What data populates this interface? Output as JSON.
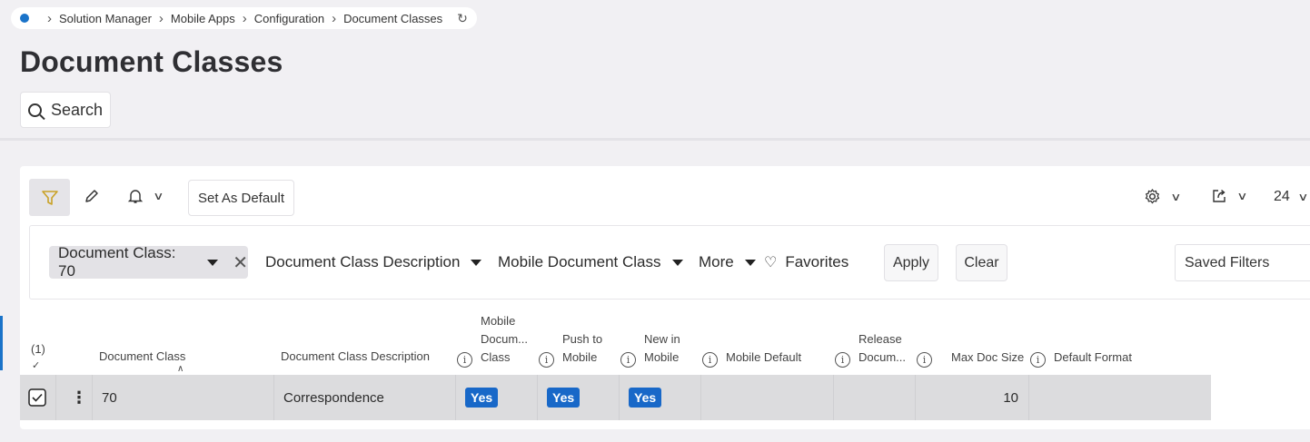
{
  "breadcrumb": {
    "items": [
      "Solution Manager",
      "Mobile Apps",
      "Configuration",
      "Document Classes"
    ]
  },
  "page": {
    "title": "Document Classes",
    "search_label": "Search"
  },
  "toolbar": {
    "set_default_label": "Set As Default",
    "page_size": "24"
  },
  "filters": {
    "chip_label": "Document Class: 70",
    "description_label": "Document Class Description",
    "mobile_class_label": "Mobile Document Class",
    "more_label": "More",
    "favorites_label": "Favorites",
    "apply_label": "Apply",
    "clear_label": "Clear",
    "saved_filters_label": "Saved Filters"
  },
  "table": {
    "selection_count": "(1)",
    "columns": {
      "document_class": "Document Class",
      "description": "Document Class Description",
      "mobile_doc_class_1": "Mobile",
      "mobile_doc_class_2": "Docum...",
      "mobile_doc_class_3": "Class",
      "push_to_mobile_1": "Push to",
      "push_to_mobile_2": "Mobile",
      "new_in_mobile_1": "New in",
      "new_in_mobile_2": "Mobile",
      "mobile_default": "Mobile Default",
      "release_1": "Release",
      "release_2": "Docum...",
      "max_doc_size": "Max Doc Size",
      "default_format": "Default Format"
    },
    "rows": [
      {
        "document_class": "70",
        "description": "Correspondence",
        "mobile_doc_class": "Yes",
        "push_to_mobile": "Yes",
        "new_in_mobile": "Yes",
        "mobile_default": "",
        "release": "",
        "max_doc_size": "10",
        "default_format": ""
      }
    ]
  },
  "colors": {
    "accent": "#1868c8",
    "filter_icon": "#c9a227",
    "row_bg": "#dcdcde"
  }
}
